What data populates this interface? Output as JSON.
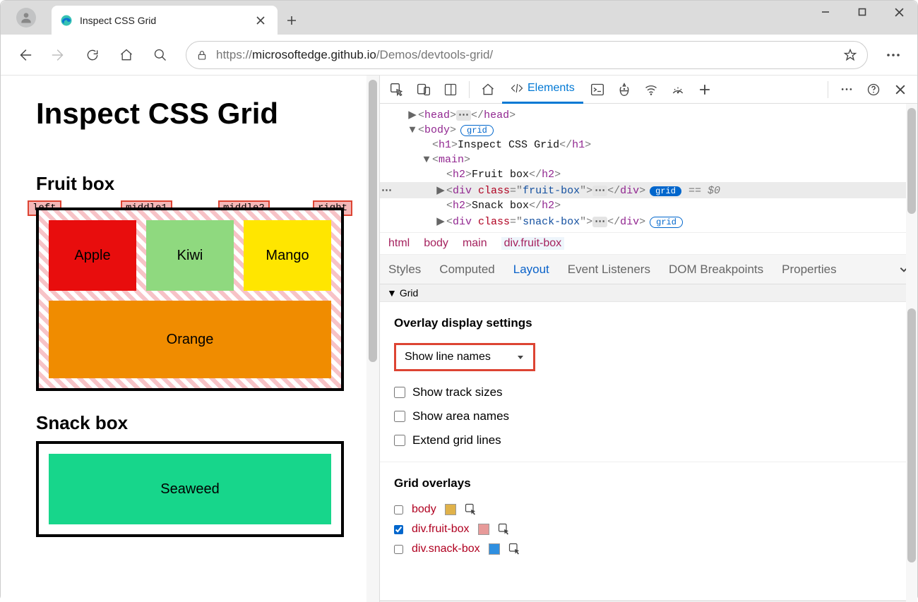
{
  "tab_title": "Inspect CSS Grid",
  "url_scheme": "https://",
  "url_host": "microsoftedge.github.io",
  "url_path": "/Demos/devtools-grid/",
  "page": {
    "h1": "Inspect CSS Grid",
    "fruit_heading": "Fruit box",
    "snack_heading": "Snack box",
    "line_left": "left",
    "line_mid1": "middle1",
    "line_mid2": "middle2",
    "line_right": "right",
    "cells": {
      "apple": "Apple",
      "kiwi": "Kiwi",
      "mango": "Mango",
      "orange": "Orange",
      "seaweed": "Seaweed"
    }
  },
  "devtools": {
    "elements_tab": "Elements",
    "breadcrumb": {
      "html": "html",
      "body": "body",
      "main": "main",
      "sel": "div.fruit-box"
    },
    "panel_tabs": {
      "styles": "Styles",
      "computed": "Computed",
      "layout": "Layout",
      "events": "Event Listeners",
      "dom": "DOM Breakpoints",
      "props": "Properties"
    },
    "grid_section": "Grid",
    "overlay_heading": "Overlay display settings",
    "dropdown": "Show line names",
    "chk_tracks": "Show track sizes",
    "chk_areas": "Show area names",
    "chk_extend": "Extend grid lines",
    "overlays_heading": "Grid overlays",
    "ov_body": "body",
    "ov_fruit": "div.fruit-box",
    "ov_snack": "div.snack-box"
  },
  "dom": {
    "head": "head",
    "body": "body",
    "h1txt": "Inspect CSS Grid",
    "main": "main",
    "h2fruit": "Fruit box",
    "h2snack": "Snack box",
    "fruit_class": "fruit-box",
    "snack_class": "snack-box",
    "grid_badge": "grid",
    "eq0": "== $0"
  }
}
